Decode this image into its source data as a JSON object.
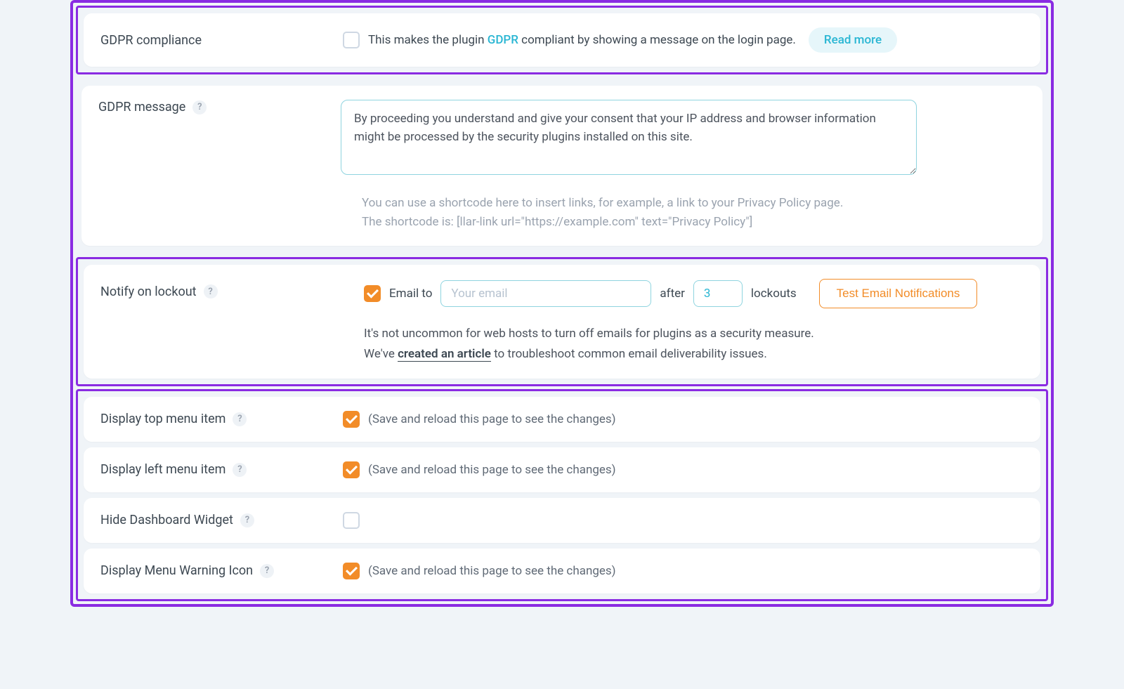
{
  "gdpr_compliance": {
    "label": "GDPR compliance",
    "desc_before": "This makes the plugin ",
    "desc_link": "GDPR",
    "desc_after": " compliant by showing a message on the login page.",
    "readmore": "Read more",
    "checked": false
  },
  "gdpr_message": {
    "label": "GDPR message",
    "help": "?",
    "value": "By proceeding you understand and give your consent that your IP address and browser information might be processed by the security plugins installed on this site.",
    "hint_line1": "You can use a shortcode here to insert links, for example, a link to your Privacy Policy page.",
    "hint_line2": "The shortcode is: [llar-link url=\"https://example.com\" text=\"Privacy Policy\"]"
  },
  "notify": {
    "label": "Notify on lockout",
    "help": "?",
    "checked": true,
    "email_to_label": "Email to",
    "email_placeholder": "Your email",
    "email_value": "",
    "after_label": "after",
    "after_value": "3",
    "lockouts_label": "lockouts",
    "test_button": "Test Email Notifications",
    "desc_line1": "It's not uncommon for web hosts to turn off emails for plugins as a security measure.",
    "desc_prefix": "We've ",
    "desc_link": "created an article",
    "desc_suffix": " to troubleshoot common email deliverability issues."
  },
  "menu": {
    "reload_note": "(Save and reload this page to see the changes)",
    "top": {
      "label": "Display top menu item",
      "help": "?",
      "checked": true
    },
    "left": {
      "label": "Display left menu item",
      "help": "?",
      "checked": true
    },
    "hide_widget": {
      "label": "Hide Dashboard Widget",
      "help": "?",
      "checked": false
    },
    "warning_icon": {
      "label": "Display Menu Warning Icon",
      "help": "?",
      "checked": true
    }
  }
}
